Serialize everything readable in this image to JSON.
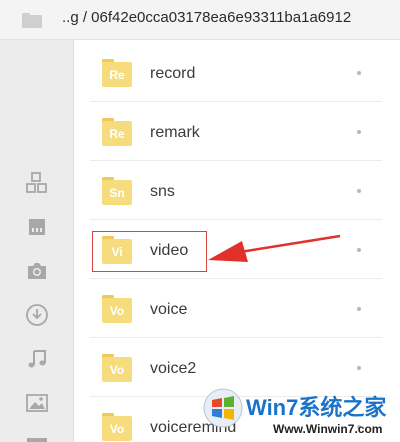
{
  "header": {
    "path": "..g / 06f42e0cca03178ea6e93311ba1a6912"
  },
  "sidebar": {
    "icons": [
      "category-icon",
      "sd-card-icon",
      "camera-icon",
      "download-icon",
      "music-icon",
      "image-icon",
      "video-icon"
    ]
  },
  "files": [
    {
      "tag": "Re",
      "name": "record"
    },
    {
      "tag": "Re",
      "name": "remark"
    },
    {
      "tag": "Sn",
      "name": "sns"
    },
    {
      "tag": "Vi",
      "name": "video"
    },
    {
      "tag": "Vo",
      "name": "voice"
    },
    {
      "tag": "Vo",
      "name": "voice2"
    },
    {
      "tag": "Vo",
      "name": "voiceremind"
    }
  ],
  "colors": {
    "folder": "#f7dc7e",
    "folder_tab": "#efc95a",
    "highlight": "#d9433f",
    "watermark_blue": "#1a73c9"
  },
  "watermark": {
    "brand": "Win7系统之家",
    "url": "Www.Winwin7.com"
  }
}
